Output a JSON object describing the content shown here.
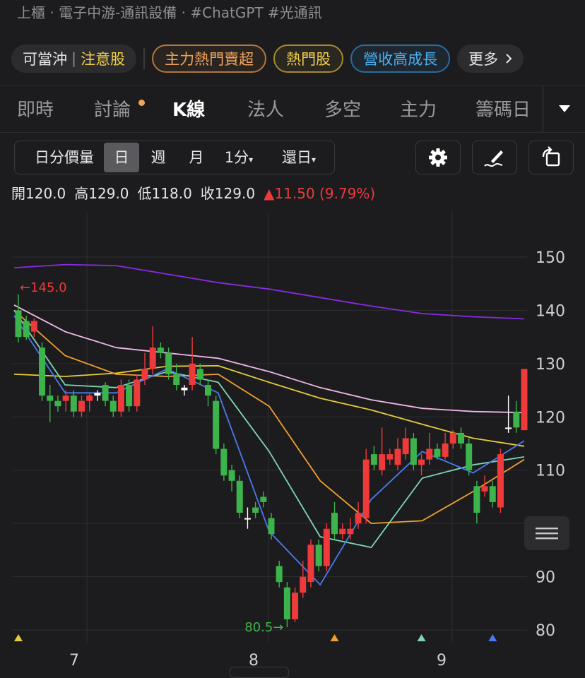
{
  "breadcrumb": "上櫃 · 電子中游-通訊設備 · #ChatGPT #光通訊",
  "tags": {
    "daytrade": "可當沖",
    "caution": "注意股",
    "hot_sell": "主力熱門賣超",
    "hot": "熱門股",
    "revenue": "營收高成長",
    "more": "更多"
  },
  "tabs": [
    "即時",
    "討論",
    "K線",
    "法人",
    "多空",
    "主力",
    "籌碼日"
  ],
  "active_tab": "K線",
  "periods": {
    "volume_label": "日分價量",
    "day": "日",
    "week": "週",
    "month": "月",
    "minute": "1分",
    "adjust": "還日"
  },
  "ohlc": {
    "open_label": "開",
    "open": "120.0",
    "high_label": "高",
    "high": "129.0",
    "low_label": "低",
    "low": "118.0",
    "close_label": "收",
    "close": "129.0",
    "change": "▲11.50 (9.79%)"
  },
  "icons": {
    "settings": "gear-icon",
    "draw": "pen-icon",
    "rotate": "rotate-icon",
    "more_arrow": "chevron-right-icon",
    "tab_dropdown": "triangle-down-icon",
    "chart_handle": "lines-icon"
  },
  "colors": {
    "up": "#ee3a3a",
    "down": "#3cb44b",
    "ma_blue": "#4a7af0",
    "ma_green": "#7ed6b4",
    "ma_orange": "#f0a030",
    "ma_yellow": "#e6cc3a",
    "ma_pink": "#f0b8e6",
    "ma_purple": "#8a2be2"
  },
  "chart_data": {
    "type": "candlestick",
    "y_ticks": [
      150,
      140,
      130,
      120,
      110,
      100,
      90,
      80
    ],
    "x_ticks": [
      "7",
      "8",
      "9"
    ],
    "ylim": [
      78,
      155
    ],
    "max_marker": "←145.0",
    "min_marker": "80.5→",
    "candles": [
      [
        140.0,
        135.0,
        143.0,
        134.0
      ],
      [
        138.0,
        135.0,
        139.0,
        134.5
      ],
      [
        136.0,
        138.0,
        138.5,
        135.0
      ],
      [
        133.0,
        124.0,
        134.0,
        123.0
      ],
      [
        124.0,
        123.0,
        126.0,
        119.0
      ],
      [
        123.0,
        122.0,
        124.0,
        121.0
      ],
      [
        123.0,
        124.0,
        125.0,
        121.0
      ],
      [
        124.0,
        121.0,
        125.0,
        120.0
      ],
      [
        121.0,
        123.0,
        124.0,
        120.0
      ],
      [
        123.0,
        124.0,
        124.5,
        121.0
      ],
      [
        124.5,
        124.0,
        125.0,
        123.0
      ],
      [
        126.0,
        123.0,
        126.5,
        122.0
      ],
      [
        123.0,
        121.0,
        124.0,
        120.0
      ],
      [
        121.0,
        126.0,
        127.0,
        120.0
      ],
      [
        126.0,
        122.0,
        127.0,
        121.0
      ],
      [
        122.0,
        127.0,
        128.0,
        121.0
      ],
      [
        127.0,
        129.0,
        132.0,
        126.0
      ],
      [
        129.0,
        133.0,
        137.0,
        128.0
      ],
      [
        133.0,
        132.0,
        134.0,
        131.0
      ],
      [
        132.0,
        128.0,
        133.0,
        127.0
      ],
      [
        128.0,
        126.0,
        130.0,
        125.0
      ],
      [
        125.5,
        125.0,
        126.0,
        124.0
      ],
      [
        126.0,
        130.0,
        135.0,
        125.0
      ],
      [
        129.0,
        127.0,
        130.0,
        126.0
      ],
      [
        126.0,
        124.0,
        127.0,
        122.0
      ],
      [
        123.0,
        114.0,
        124.0,
        113.0
      ],
      [
        114.0,
        109.0,
        115.0,
        108.0
      ],
      [
        110.0,
        108.0,
        111.0,
        106.0
      ],
      [
        108.0,
        102.0,
        109.0,
        101.0
      ],
      [
        101.0,
        101.0,
        103.0,
        99.0
      ],
      [
        103.0,
        102.0,
        104.0,
        101.0
      ],
      [
        105.0,
        104.0,
        106.0,
        103.0
      ],
      [
        101.0,
        98.0,
        102.0,
        97.0
      ],
      [
        92.0,
        89.0,
        93.0,
        88.0
      ],
      [
        88.0,
        82.0,
        89.0,
        80.5
      ],
      [
        82.0,
        87.0,
        88.0,
        81.5
      ],
      [
        87.0,
        90.0,
        93.0,
        86.0
      ],
      [
        89.0,
        96.0,
        97.0,
        88.0
      ],
      [
        96.0,
        92.0,
        97.0,
        91.0
      ],
      [
        92.0,
        99.0,
        100.0,
        91.0
      ],
      [
        102.0,
        98.0,
        104.0,
        97.0
      ],
      [
        98.0,
        99.0,
        100.0,
        97.0
      ],
      [
        98.0,
        99.0,
        101.0,
        97.0
      ],
      [
        100.0,
        102.0,
        104.0,
        99.0
      ],
      [
        101.0,
        112.0,
        114.0,
        100.0
      ],
      [
        113.0,
        111.0,
        114.5,
        110.0
      ],
      [
        110.0,
        113.0,
        118.0,
        109.0
      ],
      [
        112.0,
        113.0,
        114.0,
        111.0
      ],
      [
        111.0,
        114.0,
        116.0,
        110.0
      ],
      [
        113.0,
        116.0,
        118.0,
        112.0
      ],
      [
        116.0,
        111.0,
        117.0,
        110.0
      ],
      [
        111.0,
        112.0,
        113.0,
        109.0
      ],
      [
        112.0,
        114.0,
        117.0,
        111.0
      ],
      [
        114.0,
        112.5,
        115.0,
        112.0
      ],
      [
        112.5,
        115.0,
        117.0,
        112.0
      ],
      [
        115.0,
        117.0,
        117.5,
        114.0
      ],
      [
        117.0,
        115.0,
        118.0,
        114.0
      ],
      [
        115.0,
        110.0,
        116.0,
        109.0
      ],
      [
        107.0,
        102.0,
        108.0,
        100.0
      ],
      [
        106.0,
        107.0,
        109.0,
        105.0
      ],
      [
        107.0,
        104.0,
        108.0,
        103.0
      ],
      [
        103.0,
        113.0,
        114.0,
        102.0
      ],
      [
        118.0,
        118.0,
        124.0,
        117.0
      ],
      [
        121.0,
        118.0,
        123.0,
        117.0
      ],
      [
        117.5,
        129.0,
        129.0,
        117.5
      ]
    ],
    "moving_averages": [
      {
        "color": "#8a2be2",
        "values": [
          148.0,
          148.6,
          148.4,
          146.8,
          145.2,
          144.0,
          142.4,
          140.8,
          139.4,
          138.8,
          138.4
        ]
      },
      {
        "color": "#f0b8e6",
        "values": [
          141.0,
          136.0,
          133.0,
          132.0,
          131.0,
          128.5,
          125.5,
          123.2,
          121.6,
          121.0,
          120.8
        ]
      },
      {
        "color": "#e6cc3a",
        "values": [
          128.0,
          127.6,
          128.2,
          129.5,
          129.6,
          126.5,
          123.5,
          121.3,
          118.6,
          116.0,
          114.5
        ]
      },
      {
        "color": "#f0a030",
        "values": [
          140.0,
          131.5,
          128.0,
          127.6,
          128.0,
          122.0,
          108.0,
          100.0,
          100.5,
          106.0,
          112.0
        ]
      },
      {
        "color": "#7ed6b4",
        "values": [
          140.0,
          126.0,
          125.5,
          128.5,
          126.5,
          113.5,
          97.5,
          95.5,
          108.5,
          111.0,
          112.5
        ]
      },
      {
        "color": "#4a7af0",
        "values": [
          139.0,
          124.5,
          124.5,
          129.0,
          124.5,
          98.5,
          88.5,
          104.5,
          113.5,
          109.5,
          115.5
        ]
      }
    ],
    "markers": [
      {
        "x_index": 0,
        "color": "#e6cc3a"
      },
      {
        "x_index": 40,
        "color": "#f0a030"
      },
      {
        "x_index": 51,
        "color": "#7ed6b4"
      },
      {
        "x_index": 60,
        "color": "#4a7af0"
      }
    ]
  }
}
